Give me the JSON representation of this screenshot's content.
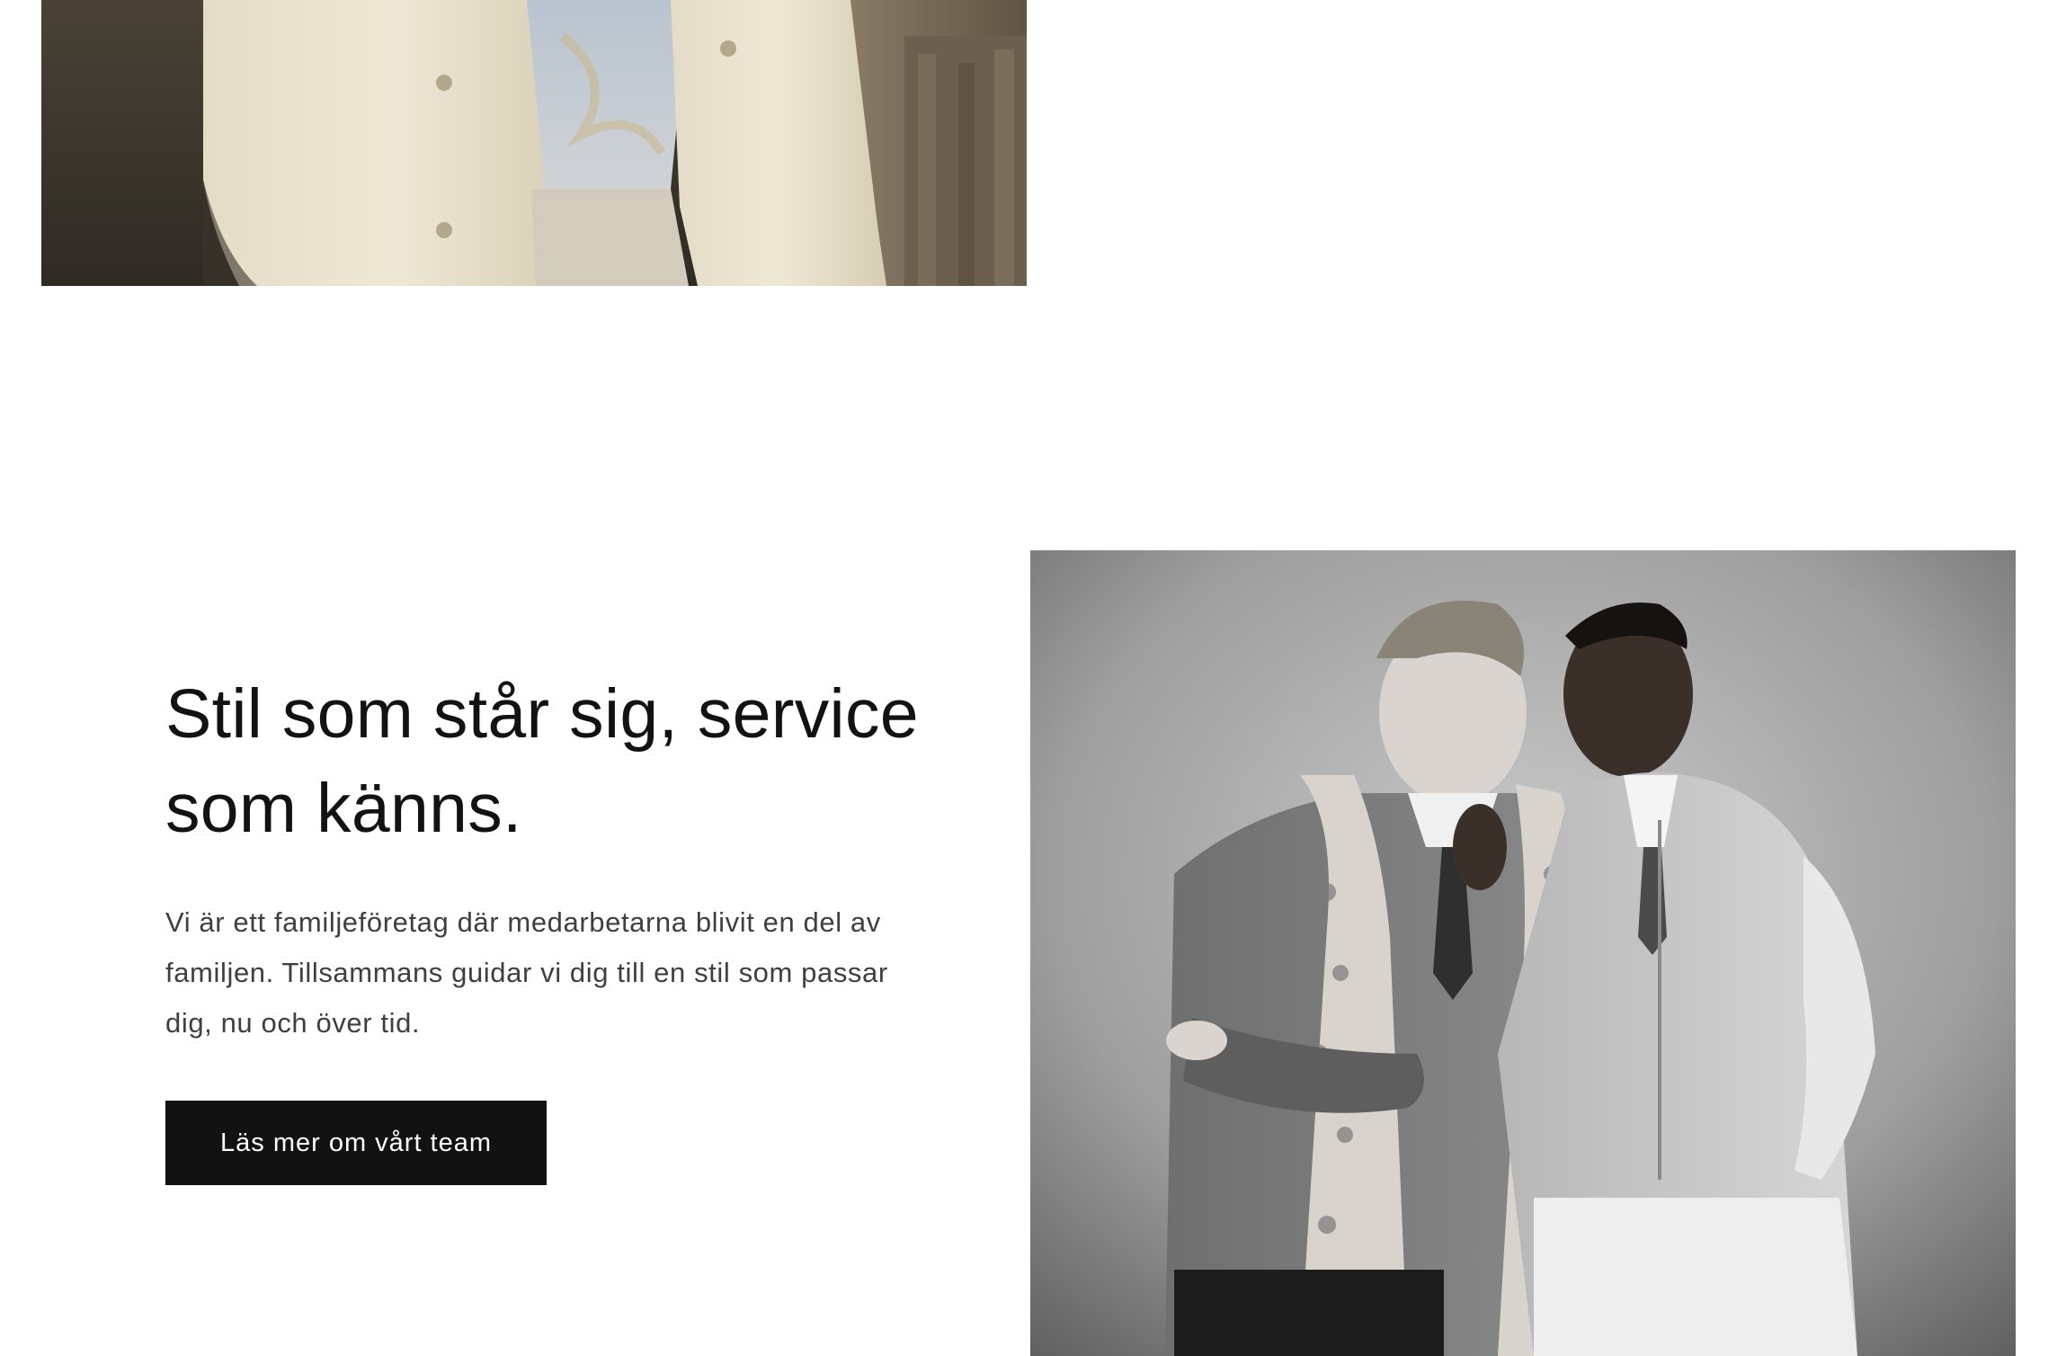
{
  "top_image": {
    "icon": "photo-man-beige-suit-icon"
  },
  "team_section": {
    "heading": "Stil som står sig, service som känns.",
    "body": "Vi är ett familjeföretag där medarbetarna blivit en del av familjen. Tillsammans guidar vi dig till en stil som passar dig, nu och över tid.",
    "cta_label": "Läs mer om vårt team",
    "image_icon": "photo-two-men-laughing-icon"
  },
  "colors": {
    "button_bg": "#121212",
    "button_text": "#ffffff",
    "heading": "#121212",
    "body_text": "#3f3f3f",
    "background": "#ffffff"
  }
}
